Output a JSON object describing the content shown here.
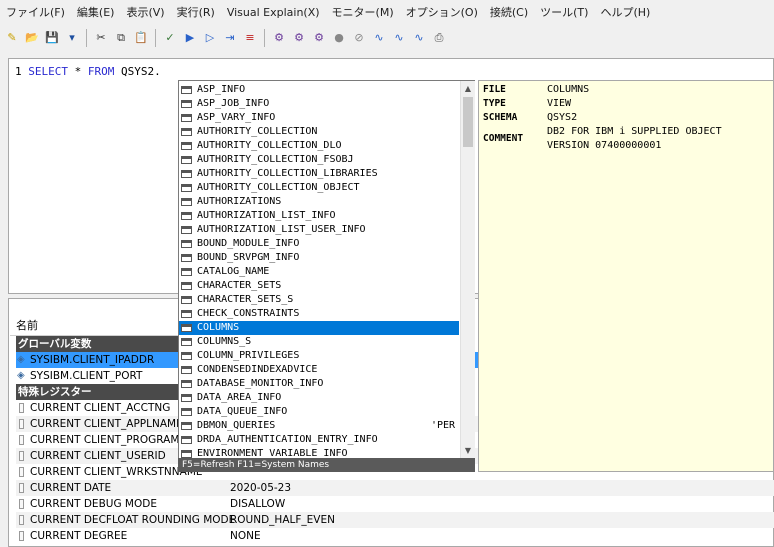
{
  "menu": [
    "ファイル(F)",
    "編集(E)",
    "表示(V)",
    "実行(R)",
    "Visual Explain(X)",
    "モニター(M)",
    "オプション(O)",
    "接続(C)",
    "ツール(T)",
    "ヘルプ(H)"
  ],
  "toolbar": [
    "new-icon",
    "open-icon",
    "save-icon",
    "save-as-icon",
    "cut-icon",
    "copy-icon",
    "paste-icon",
    "check-syntax-icon",
    "run-all-icon",
    "run-selected-icon",
    "run-from-cursor-icon",
    "format-icon",
    "explain-icon",
    "explain-run-icon",
    "visual-explain-icon",
    "stop-icon",
    "cancel-icon",
    "monitor-icon",
    "monitor2-icon",
    "monitor3-icon",
    "print-icon"
  ],
  "editor": {
    "line_number": "1",
    "keyword_select": "SELECT",
    "star": "*",
    "keyword_from": "FROM",
    "object": "QSYS2."
  },
  "autocomplete": {
    "items": [
      {
        "name": "ASP_INFO",
        "extra": ""
      },
      {
        "name": "ASP_JOB_INFO",
        "extra": ""
      },
      {
        "name": "ASP_VARY_INFO",
        "extra": ""
      },
      {
        "name": "AUTHORITY_COLLECTION",
        "extra": ""
      },
      {
        "name": "AUTHORITY_COLLECTION_DLO",
        "extra": ""
      },
      {
        "name": "AUTHORITY_COLLECTION_FSOBJ",
        "extra": ""
      },
      {
        "name": "AUTHORITY_COLLECTION_LIBRARIES",
        "extra": ""
      },
      {
        "name": "AUTHORITY_COLLECTION_OBJECT",
        "extra": ""
      },
      {
        "name": "AUTHORIZATIONS",
        "extra": ""
      },
      {
        "name": "AUTHORIZATION_LIST_INFO",
        "extra": ""
      },
      {
        "name": "AUTHORIZATION_LIST_USER_INFO",
        "extra": ""
      },
      {
        "name": "BOUND_MODULE_INFO",
        "extra": ""
      },
      {
        "name": "BOUND_SRVPGM_INFO",
        "extra": ""
      },
      {
        "name": "CATALOG_NAME",
        "extra": ""
      },
      {
        "name": "CHARACTER_SETS",
        "extra": ""
      },
      {
        "name": "CHARACTER_SETS_S",
        "extra": ""
      },
      {
        "name": "CHECK_CONSTRAINTS",
        "extra": ""
      },
      {
        "name": "COLUMNS",
        "extra": ""
      },
      {
        "name": "COLUMNS_S",
        "extra": ""
      },
      {
        "name": "COLUMN_PRIVILEGES",
        "extra": ""
      },
      {
        "name": "CONDENSEDINDEXADVICE",
        "extra": ""
      },
      {
        "name": "DATABASE_MONITOR_INFO",
        "extra": ""
      },
      {
        "name": "DATA_AREA_INFO",
        "extra": ""
      },
      {
        "name": "DATA_QUEUE_INFO",
        "extra": ""
      },
      {
        "name": "DBMON_QUERIES",
        "extra": "'PER"
      },
      {
        "name": "DRDA_AUTHENTICATION_ENTRY_INFO",
        "extra": ""
      },
      {
        "name": "ENVIRONMENT_VARIABLE_INFO",
        "extra": ""
      }
    ],
    "selected_index": 17,
    "status": "F5=Refresh  F11=System Names"
  },
  "detail": {
    "file_label": "FILE",
    "file_value": "COLUMNS",
    "type_label": "TYPE",
    "type_value": "VIEW",
    "schema_label": "SCHEMA",
    "schema_value": "QSYS2",
    "comment_label": "COMMENT",
    "comment_value": "DB2 FOR IBM i SUPPLIED OBJECT\nVERSION 07400000001"
  },
  "lower": {
    "header_name": "名前",
    "group_global": "グローバル変数",
    "globals": [
      {
        "name": "SYSIBM.CLIENT_IPADDR",
        "value": ""
      },
      {
        "name": "SYSIBM.CLIENT_PORT",
        "value": ""
      }
    ],
    "group_special": "特殊レジスター",
    "registers": [
      {
        "name": "CURRENT CLIENT_ACCTNG",
        "value": ""
      },
      {
        "name": "CURRENT CLIENT_APPLNAME",
        "value": ""
      },
      {
        "name": "CURRENT CLIENT_PROGRAMID",
        "value": ""
      },
      {
        "name": "CURRENT CLIENT_USERID",
        "value": ""
      },
      {
        "name": "CURRENT CLIENT_WRKSTNNAME",
        "value": ""
      },
      {
        "name": "CURRENT DATE",
        "value": "2020-05-23"
      },
      {
        "name": "CURRENT DEBUG MODE",
        "value": "DISALLOW"
      },
      {
        "name": "CURRENT DECFLOAT ROUNDING MODE",
        "value": "ROUND_HALF_EVEN"
      },
      {
        "name": "CURRENT DEGREE",
        "value": "NONE"
      }
    ]
  }
}
